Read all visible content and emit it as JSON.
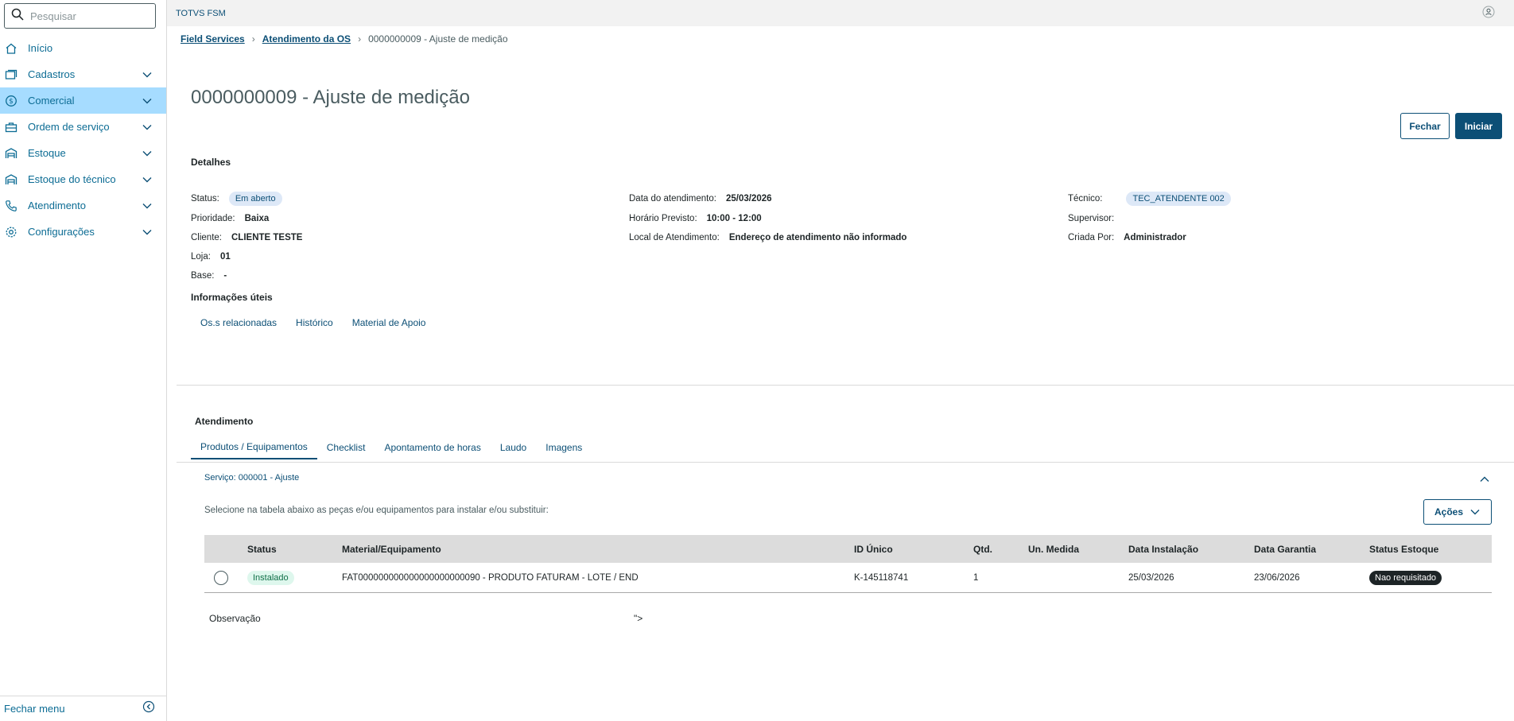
{
  "search": {
    "placeholder": "Pesquisar"
  },
  "sidebar": {
    "items": [
      {
        "label": "Início",
        "icon": "home-icon",
        "expandable": false
      },
      {
        "label": "Cadastros",
        "icon": "cards-icon",
        "expandable": true
      },
      {
        "label": "Comercial",
        "icon": "dollar-icon",
        "expandable": true,
        "active": true
      },
      {
        "label": "Ordem de serviço",
        "icon": "toolbox-icon",
        "expandable": true
      },
      {
        "label": "Estoque",
        "icon": "warehouse-icon",
        "expandable": true
      },
      {
        "label": "Estoque do técnico",
        "icon": "warehouse-icon",
        "expandable": true
      },
      {
        "label": "Atendimento",
        "icon": "phone-icon",
        "expandable": true
      },
      {
        "label": "Configurações",
        "icon": "gear-icon",
        "expandable": true
      }
    ],
    "footer_label": "Fechar menu"
  },
  "topbar": {
    "app_title": "TOTVS FSM"
  },
  "breadcrumb": {
    "items": [
      "Field Services",
      "Atendimento da OS"
    ],
    "current": "0000000009 - Ajuste de medição"
  },
  "page": {
    "title": "0000000009 - Ajuste de medição",
    "buttons": {
      "fechar": "Fechar",
      "iniciar": "Iniciar"
    }
  },
  "details": {
    "section_title": "Detalhes",
    "status": {
      "label": "Status:",
      "value": "Em aberto"
    },
    "prioridade": {
      "label": "Prioridade:",
      "value": "Baixa"
    },
    "cliente": {
      "label": "Cliente:",
      "value": "CLIENTE TESTE"
    },
    "loja": {
      "label": "Loja:",
      "value": "01"
    },
    "base": {
      "label": "Base:",
      "value": "-"
    },
    "data_atendimento": {
      "label": "Data do atendimento:",
      "value": "25/03/2026"
    },
    "horario_previsto": {
      "label": "Horário Previsto:",
      "value": "10:00 - 12:00"
    },
    "local_atendimento": {
      "label": "Local de Atendimento:",
      "value": "Endereço de atendimento não informado"
    },
    "tecnico": {
      "label": "Técnico:",
      "value": "TEC_ATENDENTE 002"
    },
    "supervisor": {
      "label": "Supervisor:",
      "value": ""
    },
    "criada_por": {
      "label": "Criada Por:",
      "value": "Administrador"
    }
  },
  "info": {
    "section_title": "Informações úteis",
    "tabs": [
      "Os.s relacionadas",
      "Histórico",
      "Material de Apoio"
    ]
  },
  "atendimento": {
    "section_title": "Atendimento",
    "tabs": [
      "Produtos / Equipamentos",
      "Checklist",
      "Apontamento de horas",
      "Laudo",
      "Imagens"
    ],
    "service_title": "Serviço: 000001 - Ajuste",
    "hint": "Selecione na tabela abaixo as peças e/ou equipamentos para instalar e/ou substituir:",
    "acoes_label": "Ações",
    "table": {
      "columns": [
        "Status",
        "Material/Equipamento",
        "ID Único",
        "Qtd.",
        "Un. Medida",
        "Data Instalação",
        "Data Garantia",
        "Status Estoque"
      ],
      "rows": [
        {
          "status": "Instalado",
          "material": "FAT000000000000000000000090 - PRODUTO FATURAM - LOTE / END",
          "id_unico": "K-145118741",
          "qtd": "1",
          "un_medida": "",
          "data_instalacao": "25/03/2026",
          "data_garantia": "23/06/2026",
          "status_estoque": "Nao requisitado"
        }
      ]
    },
    "observacao_label": "Observação",
    "observacao_value": "\">"
  },
  "colors": {
    "primary": "#0c4f76",
    "active_menu_bg": "#a6dcff",
    "menu_text": "#0c6c94",
    "tag_green_bg": "#def7ed",
    "tag_blue_bg": "#dde8f7",
    "tag_dark_bg": "#1d2426"
  }
}
